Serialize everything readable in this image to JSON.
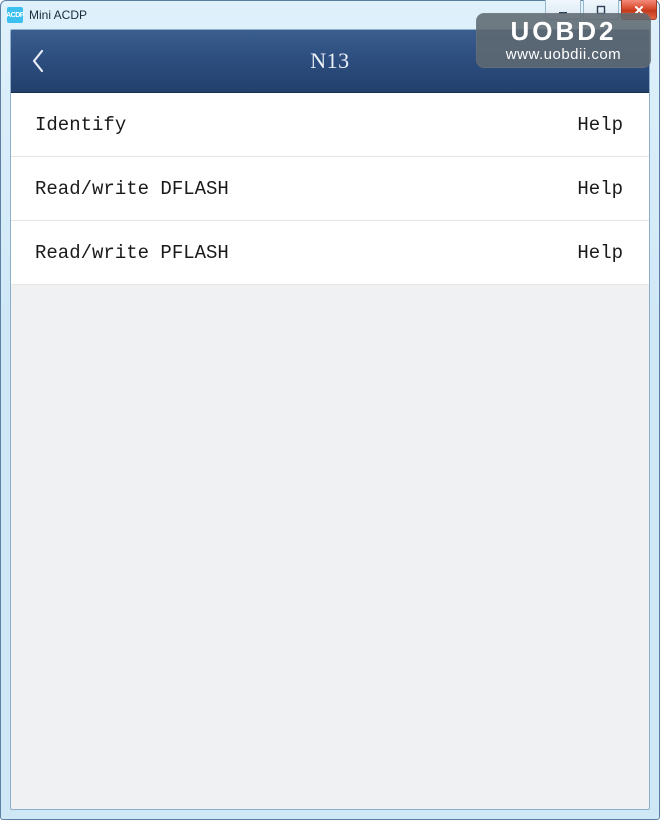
{
  "window": {
    "app_title": "Mini ACDP",
    "icon_text": "ACDP"
  },
  "navbar": {
    "title": "N13"
  },
  "menu": {
    "items": [
      {
        "label": "Identify",
        "help": "Help"
      },
      {
        "label": "Read/write DFLASH",
        "help": "Help"
      },
      {
        "label": "Read/write PFLASH",
        "help": "Help"
      }
    ]
  },
  "watermark": {
    "line1": "UOBD2",
    "line2": "www.uobdii.com"
  }
}
